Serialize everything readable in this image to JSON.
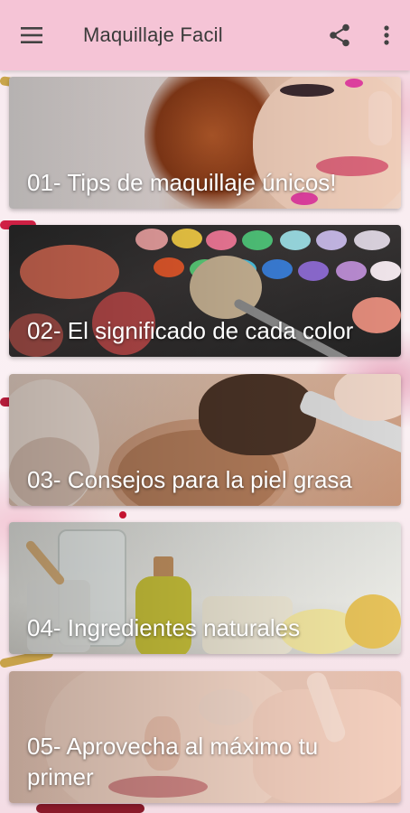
{
  "app_bar": {
    "title": "Maquillaje Facil",
    "menu_icon": "hamburger-menu-icon",
    "share_icon": "share-icon",
    "overflow_icon": "more-vert-icon",
    "background": "#f5c4d6"
  },
  "cards": [
    {
      "label": "01- Tips de maquillaje únicos!",
      "image": "woman-face-makeup-photo"
    },
    {
      "label": "02- El significado de cada color",
      "image": "eyeshadow-palette-brush-photo"
    },
    {
      "label": "03- Consejos para la piel grasa",
      "image": "face-powder-brush-photo"
    },
    {
      "label": "04- Ingredientes naturales",
      "image": "natural-oils-jars-photo"
    },
    {
      "label": "05- Aprovecha al máximo tu primer",
      "image": "woman-applying-primer-photo"
    }
  ],
  "colors": {
    "accent_pink": "#f5c4d6",
    "card_text": "#ffffff"
  }
}
